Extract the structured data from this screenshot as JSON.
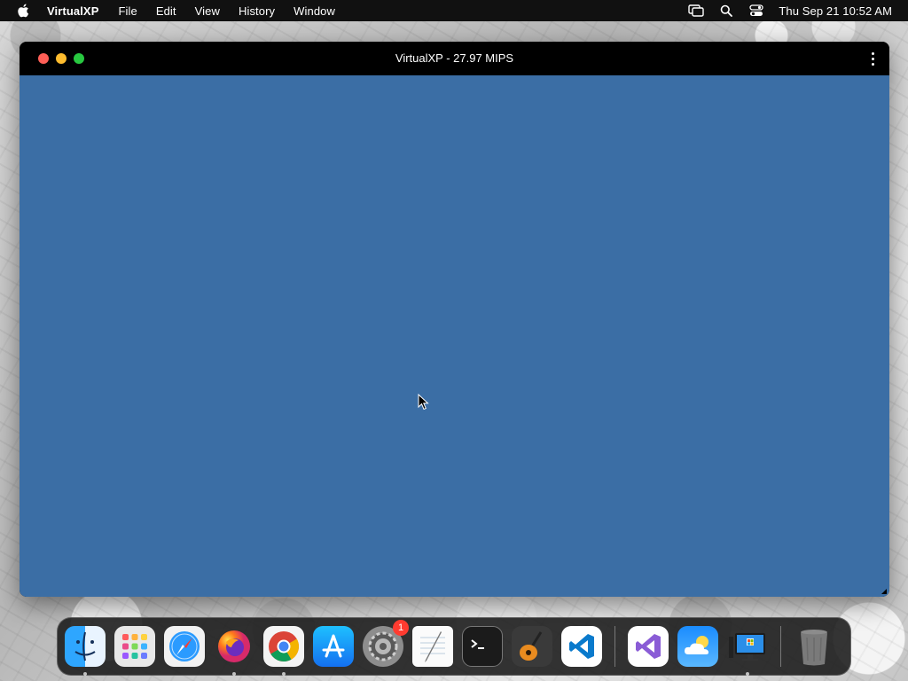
{
  "menubar": {
    "app_name": "VirtualXP",
    "items": [
      "File",
      "Edit",
      "View",
      "History",
      "Window"
    ],
    "clock": "Thu Sep 21  10:52 AM"
  },
  "window": {
    "title": "VirtualXP - 27.97 MIPS",
    "screen_color": "#3b6ea5"
  },
  "dock": {
    "apps": [
      {
        "name": "finder-icon",
        "running": true
      },
      {
        "name": "launchpad-icon",
        "running": false
      },
      {
        "name": "safari-icon",
        "running": false
      },
      {
        "name": "firefox-icon",
        "running": true
      },
      {
        "name": "chrome-icon",
        "running": true
      },
      {
        "name": "app-store-icon",
        "running": false
      },
      {
        "name": "system-settings-icon",
        "running": false,
        "badge": "1"
      },
      {
        "name": "textedit-icon",
        "running": false
      },
      {
        "name": "terminal-icon",
        "running": false
      },
      {
        "name": "garageband-icon",
        "running": false
      },
      {
        "name": "vscode-icon",
        "running": false
      }
    ],
    "recent": [
      {
        "name": "visual-studio-icon",
        "running": false
      },
      {
        "name": "weather-icon",
        "running": false
      },
      {
        "name": "virtualxp-icon",
        "running": true
      }
    ],
    "trash": {
      "name": "trash-icon"
    }
  }
}
